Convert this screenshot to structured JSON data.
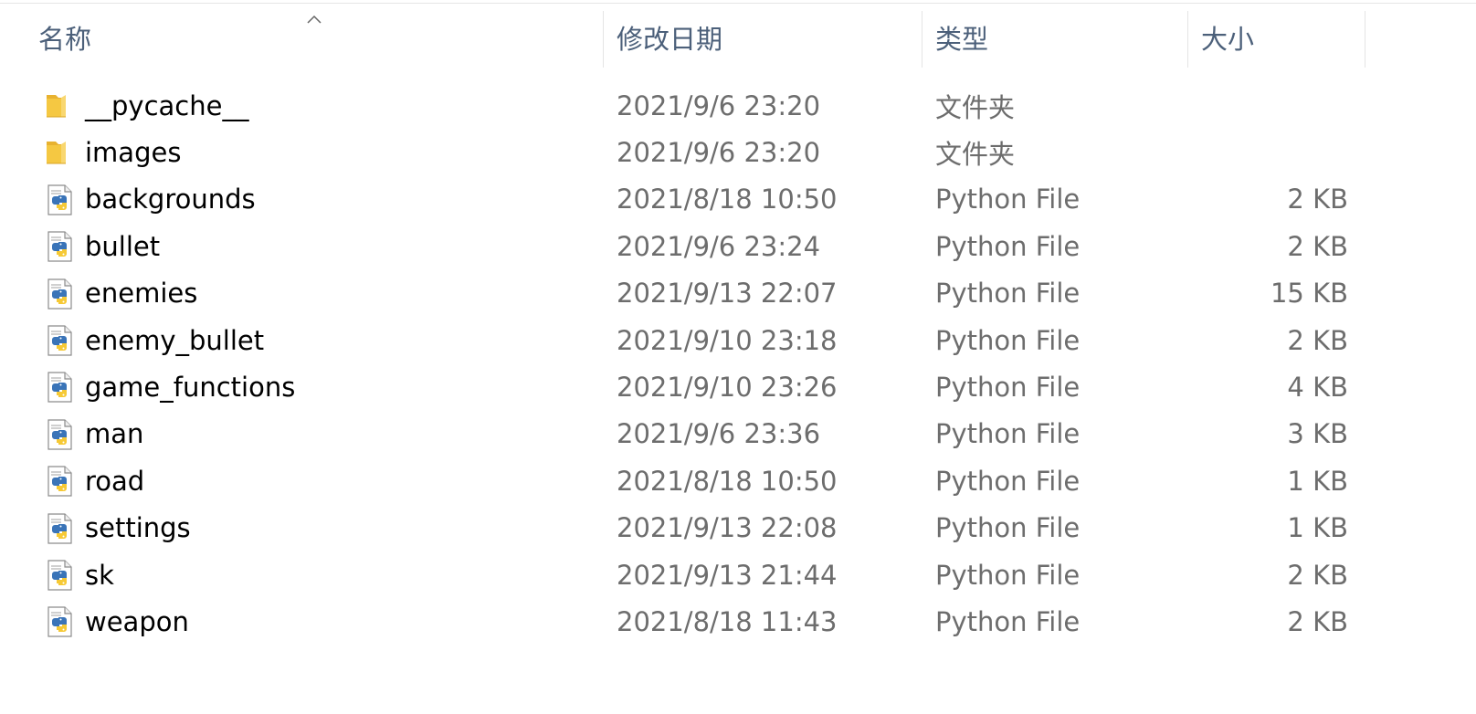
{
  "columns": {
    "name": "名称",
    "date": "修改日期",
    "type": "类型",
    "size": "大小"
  },
  "sort": {
    "column": "name",
    "direction": "ascending"
  },
  "files": [
    {
      "name": "__pycache__",
      "date": "2021/9/6 23:20",
      "type": "文件夹",
      "size": "",
      "icon": "folder-icon"
    },
    {
      "name": "images",
      "date": "2021/9/6 23:20",
      "type": "文件夹",
      "size": "",
      "icon": "folder-icon"
    },
    {
      "name": "backgrounds",
      "date": "2021/8/18 10:50",
      "type": "Python File",
      "size": "2 KB",
      "icon": "python-file-icon"
    },
    {
      "name": "bullet",
      "date": "2021/9/6 23:24",
      "type": "Python File",
      "size": "2 KB",
      "icon": "python-file-icon"
    },
    {
      "name": "enemies",
      "date": "2021/9/13 22:07",
      "type": "Python File",
      "size": "15 KB",
      "icon": "python-file-icon"
    },
    {
      "name": "enemy_bullet",
      "date": "2021/9/10 23:18",
      "type": "Python File",
      "size": "2 KB",
      "icon": "python-file-icon"
    },
    {
      "name": "game_functions",
      "date": "2021/9/10 23:26",
      "type": "Python File",
      "size": "4 KB",
      "icon": "python-file-icon"
    },
    {
      "name": "man",
      "date": "2021/9/6 23:36",
      "type": "Python File",
      "size": "3 KB",
      "icon": "python-file-icon"
    },
    {
      "name": "road",
      "date": "2021/8/18 10:50",
      "type": "Python File",
      "size": "1 KB",
      "icon": "python-file-icon"
    },
    {
      "name": "settings",
      "date": "2021/9/13 22:08",
      "type": "Python File",
      "size": "1 KB",
      "icon": "python-file-icon"
    },
    {
      "name": "sk",
      "date": "2021/9/13 21:44",
      "type": "Python File",
      "size": "2 KB",
      "icon": "python-file-icon"
    },
    {
      "name": "weapon",
      "date": "2021/8/18 11:43",
      "type": "Python File",
      "size": "2 KB",
      "icon": "python-file-icon"
    }
  ],
  "colors": {
    "header_text": "#4c607a",
    "name_text": "#000000",
    "meta_text": "#6d6d6d",
    "folder_yellow": "#f5c842",
    "python_blue": "#3a74b8",
    "python_yellow": "#f6c935"
  }
}
